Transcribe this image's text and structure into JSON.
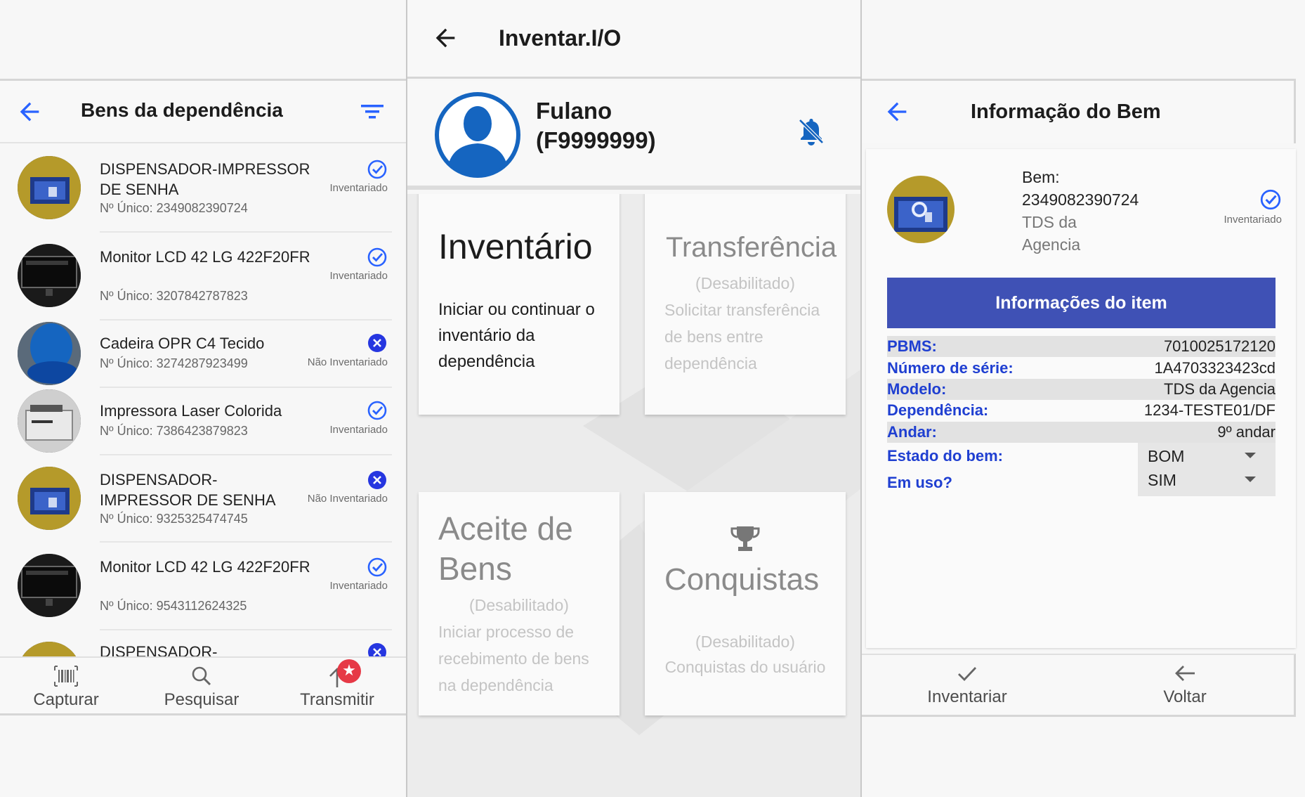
{
  "colors": {
    "accent": "#3f51b5",
    "label_blue": "#1f3fd1",
    "check_blue": "#2962ff",
    "badge_red": "#e63946"
  },
  "list_screen": {
    "title": "Bens da dependência",
    "icons": [
      "back-arrow-icon",
      "filter-icon"
    ],
    "items": [
      {
        "name": "DISPENSADOR-IMPRESSOR DE SENHA",
        "number": "Nº Único: 2349082390724",
        "status": "Inventariado",
        "status_icon": "check-circle-icon"
      },
      {
        "name": "Monitor LCD 42 LG 422F20FR",
        "number": "Nº Único: 3207842787823",
        "status": "Inventariado",
        "status_icon": "check-circle-icon"
      },
      {
        "name": "Cadeira OPR C4 Tecido",
        "number": "Nº Único: 3274287923499",
        "status": "Não Inventariado",
        "status_icon": "x-circle-icon"
      },
      {
        "name": "Impressora Laser Colorida",
        "number": "Nº Único: 7386423879823",
        "status": "Inventariado",
        "status_icon": "check-circle-icon"
      },
      {
        "name": "DISPENSADOR-IMPRESSOR DE SENHA",
        "number": "Nº Único: 9325325474745",
        "status": "Não Inventariado",
        "status_icon": "x-circle-icon"
      },
      {
        "name": "Monitor LCD 42 LG 422F20FR",
        "number": "Nº Único: 9543112624325",
        "status": "Inventariado",
        "status_icon": "check-circle-icon"
      },
      {
        "name": "DISPENSADOR-",
        "number": "",
        "status": "",
        "status_icon": "x-circle-icon"
      }
    ],
    "nav": {
      "capture": "Capturar",
      "search": "Pesquisar",
      "transmit": "Transmitir",
      "transmit_badge": "★"
    }
  },
  "home_screen": {
    "app_title": "Inventar.I/O",
    "user_name": "Fulano",
    "user_id": "(F9999999)",
    "cards": {
      "inventory": {
        "title": "Inventário",
        "desc": "Iniciar ou continuar o inventário da dependência"
      },
      "transfer": {
        "title": "Transferência",
        "status": "(Desabilitado)",
        "desc": "Solicitar transferência de bens entre dependência"
      },
      "accept": {
        "title": "Aceite de Bens",
        "status": "(Desabilitado)",
        "desc": "Iniciar processo de recebimento de bens na dependência"
      },
      "achievements": {
        "title": "Conquistas",
        "status": "(Desabilitado)",
        "desc": "Conquistas do usuário"
      }
    }
  },
  "detail_screen": {
    "title": "Informação do Bem",
    "asset_label": "Bem:",
    "asset_number": "2349082390724",
    "asset_location": "TDS da Agencia",
    "status": "Inventariado",
    "info_header": "Informações do item",
    "rows": [
      {
        "k": "PBMS:",
        "v": "7010025172120"
      },
      {
        "k": "Número de série:",
        "v": "1A4703323423cd"
      },
      {
        "k": "Modelo:",
        "v": "TDS da Agencia"
      },
      {
        "k": "Dependência:",
        "v": "1234-TESTE01/DF"
      },
      {
        "k": "Andar:",
        "v": "9º andar"
      }
    ],
    "state_label": "Estado do bem:",
    "state_value": "BOM",
    "in_use_label": "Em uso?",
    "in_use_value": "SIM",
    "nav": {
      "inventory": "Inventariar",
      "back": "Voltar"
    }
  }
}
